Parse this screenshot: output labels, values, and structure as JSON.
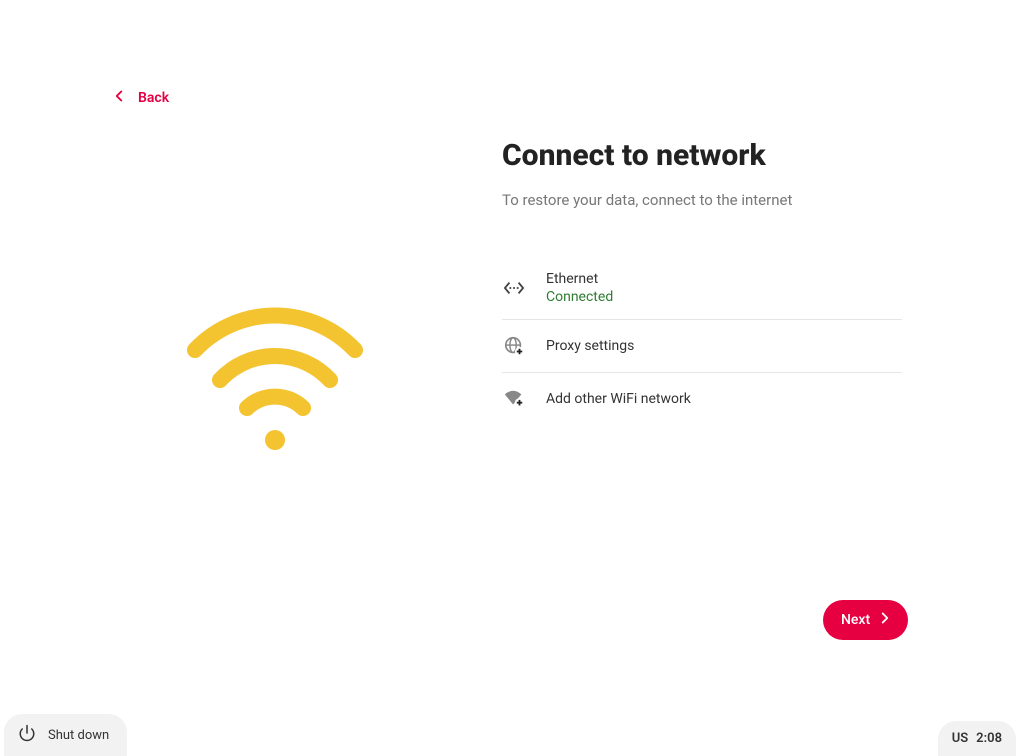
{
  "back": {
    "label": "Back"
  },
  "page": {
    "title": "Connect to network",
    "subtitle": "To restore your data, connect to the internet"
  },
  "network": {
    "ethernet": {
      "label": "Ethernet",
      "status": "Connected"
    },
    "proxy": {
      "label": "Proxy settings"
    },
    "add_wifi": {
      "label": "Add other WiFi network"
    }
  },
  "next": {
    "label": "Next"
  },
  "bottom": {
    "shutdown": "Shut down",
    "locale": "US",
    "time": "2:08"
  }
}
